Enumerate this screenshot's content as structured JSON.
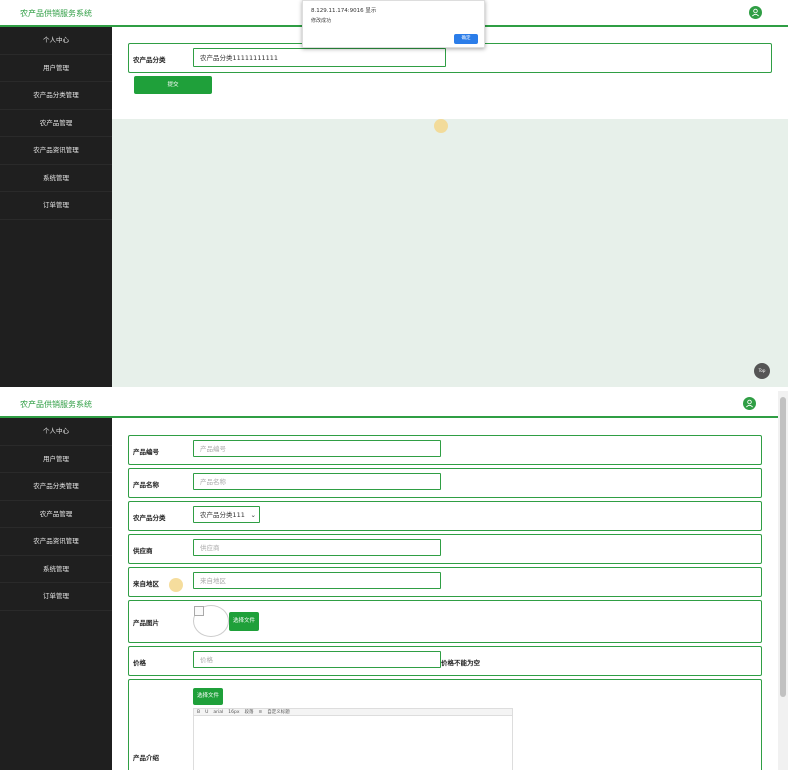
{
  "app": {
    "brand": "农产品供销服务系统",
    "sidebar": [
      "个人中心",
      "用户管理",
      "农产品分类管理",
      "农产品管理",
      "农产品资讯管理",
      "系统管理",
      "订单管理"
    ]
  },
  "top": {
    "form": {
      "category_label": "农产品分类",
      "category_value": "农产品分类11111111111",
      "submit_label": "提交"
    },
    "dialog": {
      "origin": "8.129.11.174:9016 显示",
      "message": "修改成功",
      "ok_label": "确定"
    },
    "back_to_top": "Top"
  },
  "bottom": {
    "fields": {
      "code_label": "产品编号",
      "code_placeholder": "产品编号",
      "name_label": "产品名称",
      "name_placeholder": "产品名称",
      "category_label": "农产品分类",
      "category_selected": "农产品分类111",
      "supplier_label": "供应商",
      "supplier_placeholder": "供应商",
      "origin_label": "来自地区",
      "origin_placeholder": "来自地区",
      "image_label": "产品图片",
      "image_button": "选择文件",
      "price_label": "价格",
      "price_placeholder": "价格",
      "price_error": "价格不能为空",
      "intro_label": "产品介绍",
      "intro_button": "选择文件"
    },
    "editor_toolbar": {
      "font": "arial",
      "size": "16px",
      "style": "段落",
      "format": "自定义标题"
    }
  },
  "colors": {
    "accent": "#2f9e44",
    "sidebar": "#1f1f1f",
    "canvas": "#e7f0ea"
  }
}
